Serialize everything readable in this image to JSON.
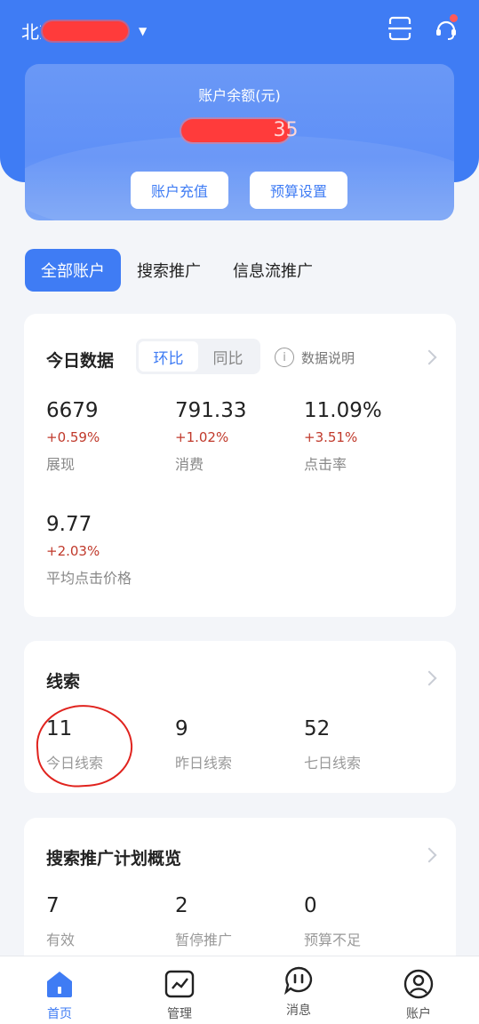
{
  "header": {
    "account_name": "北京",
    "scan_icon": "scan-icon",
    "service_icon": "customer-service-icon"
  },
  "balance": {
    "label": "账户余额(元)",
    "value": "35",
    "recharge_label": "账户充值",
    "budget_label": "预算设置"
  },
  "tabs": [
    {
      "label": "全部账户",
      "active": true
    },
    {
      "label": "搜索推广",
      "active": false
    },
    {
      "label": "信息流推广",
      "active": false
    }
  ],
  "today": {
    "title": "今日数据",
    "seg": [
      "环比",
      "同比"
    ],
    "info_label": "数据说明",
    "metrics": [
      {
        "value": "6679",
        "change": "+0.59%",
        "label": "展现"
      },
      {
        "value": "791.33",
        "change": "+1.02%",
        "label": "消费"
      },
      {
        "value": "11.09%",
        "change": "+3.51%",
        "label": "点击率"
      },
      {
        "value": "9.77",
        "change": "+2.03%",
        "label": "平均点击价格"
      }
    ]
  },
  "leads": {
    "title": "线索",
    "items": [
      {
        "value": "11",
        "label": "今日线索"
      },
      {
        "value": "9",
        "label": "昨日线索"
      },
      {
        "value": "52",
        "label": "七日线索"
      }
    ]
  },
  "plans": {
    "title": "搜索推广计划概览",
    "items": [
      {
        "value": "7",
        "label": "有效"
      },
      {
        "value": "2",
        "label": "暂停推广"
      },
      {
        "value": "0",
        "label": "预算不足"
      }
    ]
  },
  "nav": [
    {
      "label": "首页",
      "icon": "home-icon",
      "active": true
    },
    {
      "label": "管理",
      "icon": "chart-icon",
      "active": false
    },
    {
      "label": "消息",
      "icon": "message-icon",
      "active": false
    },
    {
      "label": "账户",
      "icon": "user-icon",
      "active": false
    }
  ],
  "colors": {
    "primary": "#3f7cf4",
    "increase": "#c0392b"
  }
}
